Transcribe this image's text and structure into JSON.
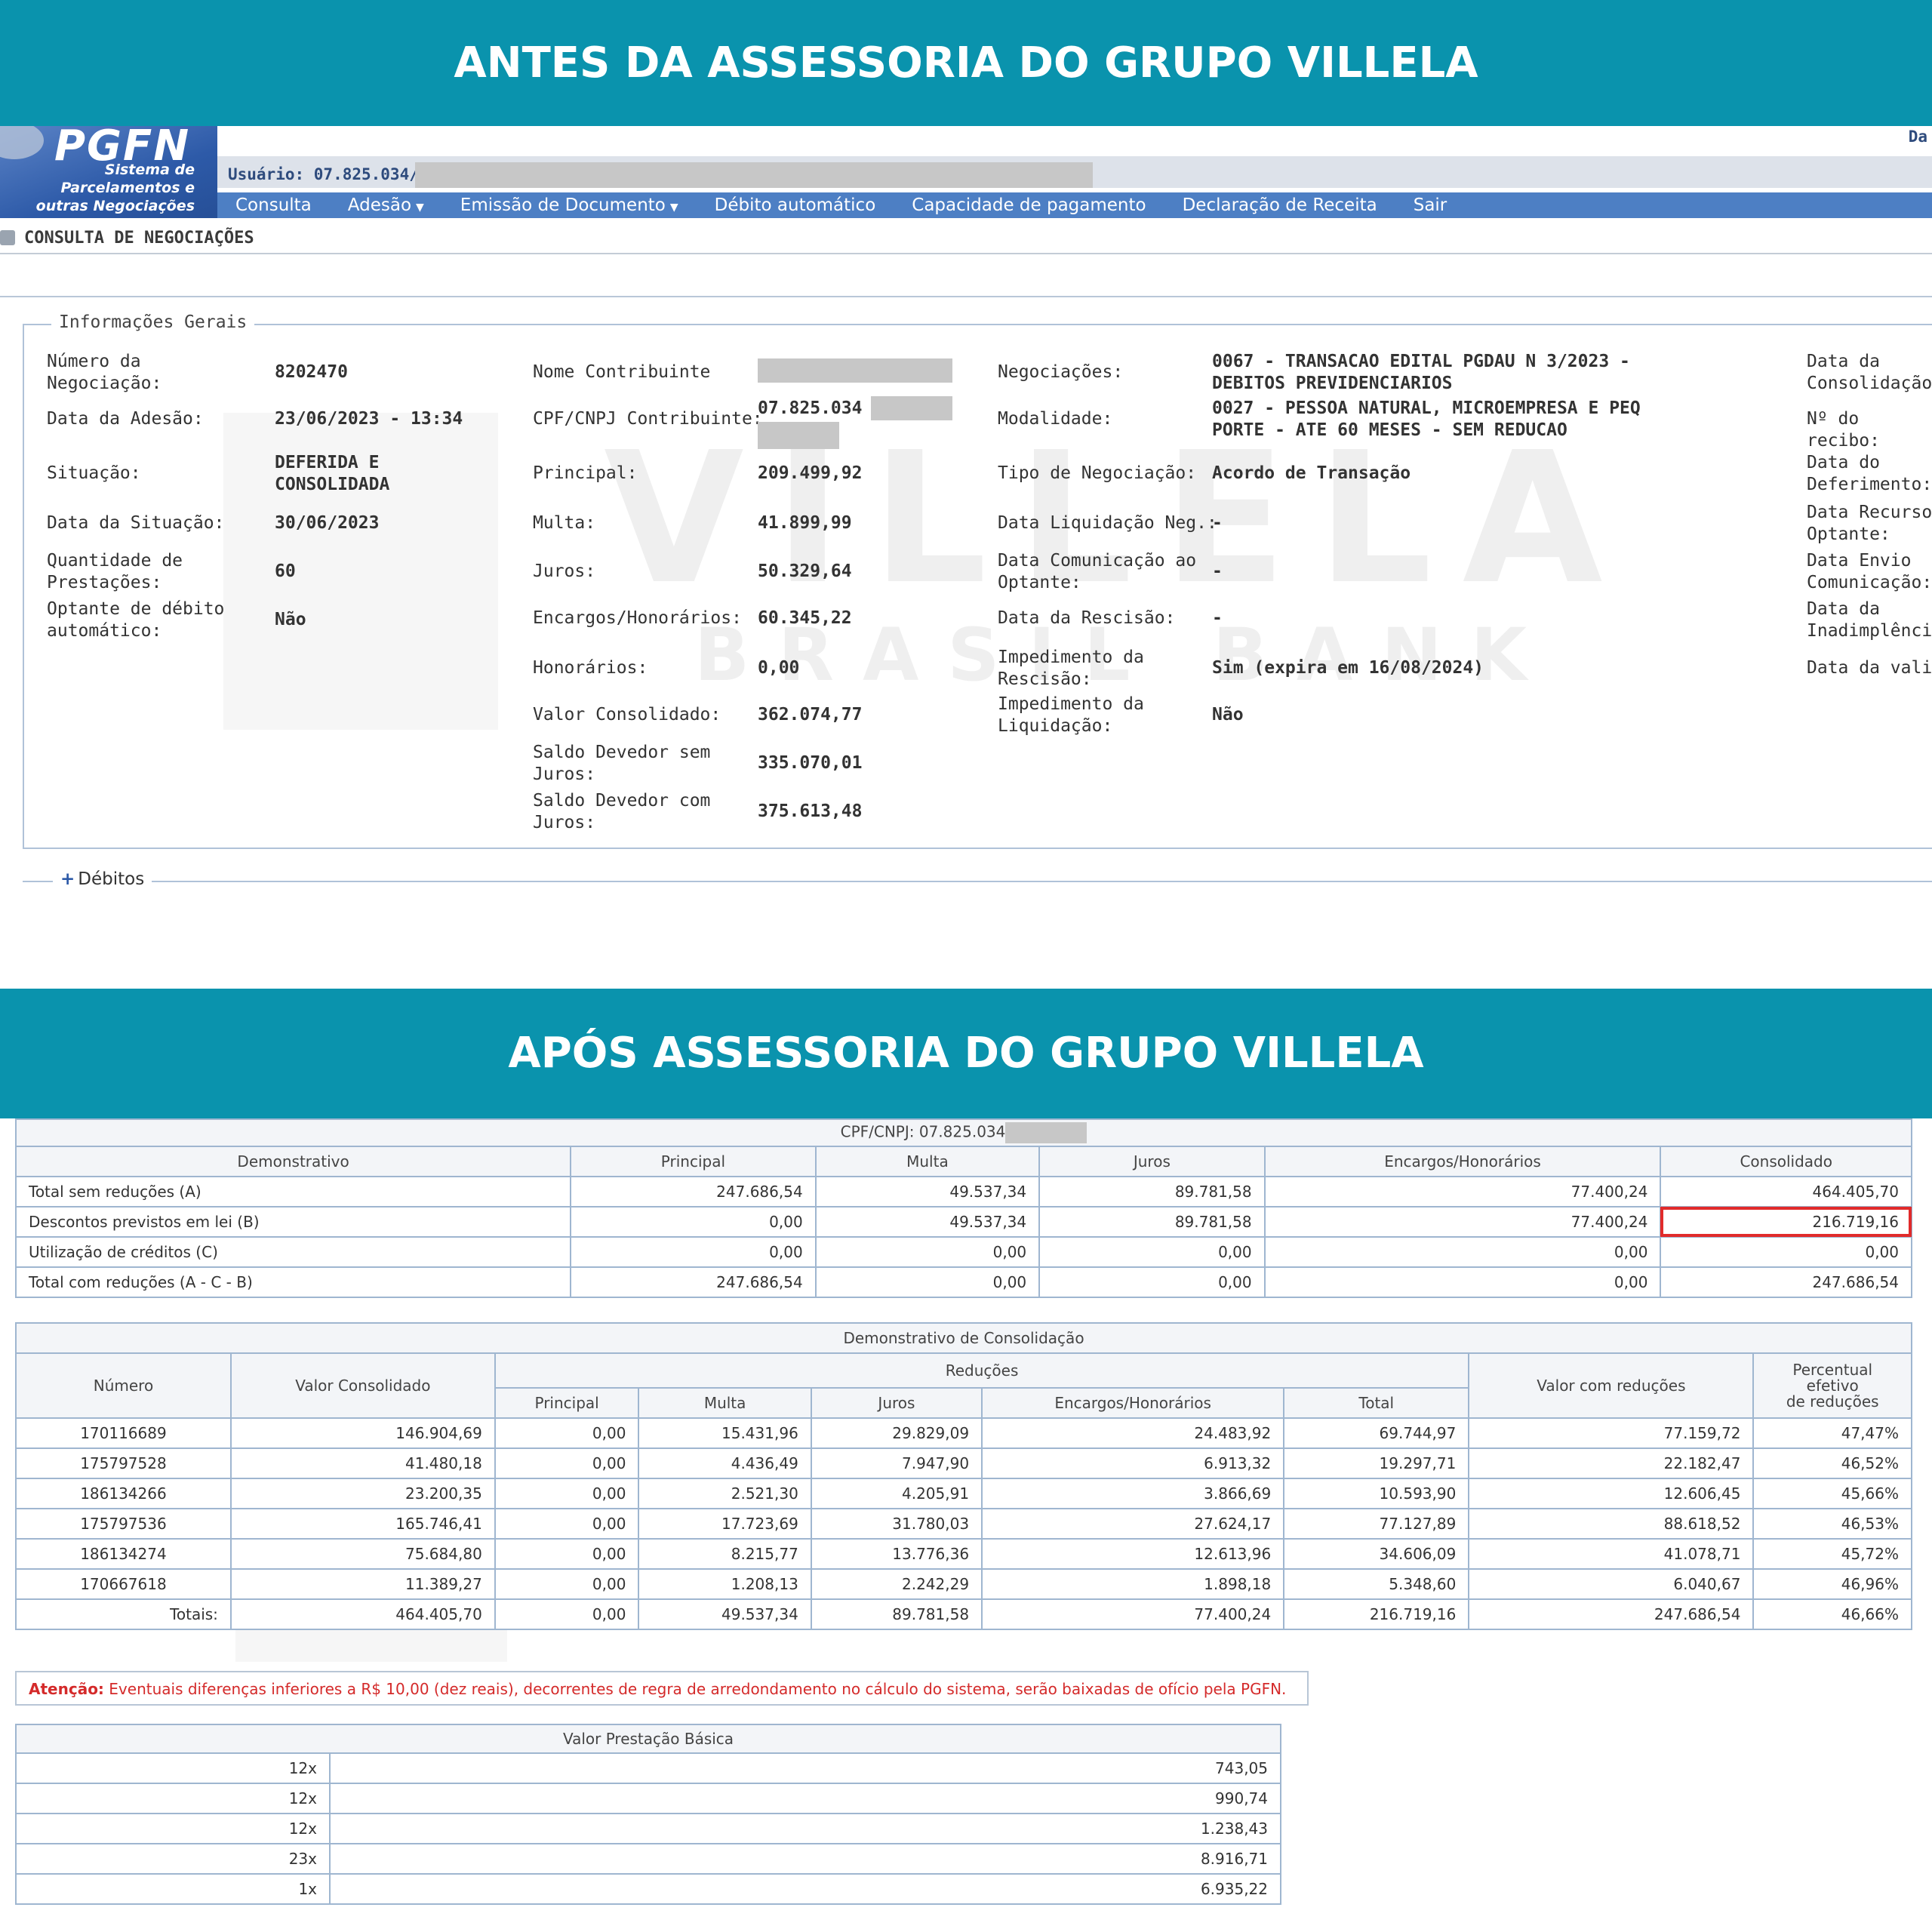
{
  "banners": {
    "before": "ANTES DA ASSESSORIA DO GRUPO VILLELA",
    "after": "APÓS ASSESSORIA DO GRUPO VILLELA"
  },
  "watermark": {
    "brand": "VILLELA",
    "sub": "BRASIL BANK"
  },
  "colors": {
    "banner": "#0a93ad",
    "menu": "#4d7fc4",
    "highlight": "#e12b2b",
    "warning": "#d42a2a"
  },
  "pgfn": {
    "logo": "PGFN",
    "logo_sub": [
      "Sistema de",
      "Parcelamentos e",
      "outras Negociações"
    ],
    "user_label": "Usuário: 07.825.034/",
    "top_right": "Da",
    "menu": [
      {
        "label": "Consulta",
        "caret": false
      },
      {
        "label": "Adesão",
        "caret": true
      },
      {
        "label": "Emissão de Documento",
        "caret": true
      },
      {
        "label": "Débito automático",
        "caret": false
      },
      {
        "label": "Capacidade de pagamento",
        "caret": false
      },
      {
        "label": "Declaração de Receita",
        "caret": false
      },
      {
        "label": "Sair",
        "caret": false
      }
    ],
    "page_title": "CONSULTA DE NEGOCIAÇÕES",
    "section_title": "Informações Gerais",
    "col1": [
      {
        "label": "Número da\nNegociação:",
        "value": "8202470"
      },
      {
        "label": "Data da Adesão:",
        "value": "23/06/2023 - 13:34"
      },
      {
        "label": "Situação:",
        "value": "DEFERIDA E\nCONSOLIDADA"
      },
      {
        "label": "Data da Situação:",
        "value": "30/06/2023"
      },
      {
        "label": "Quantidade de\nPrestações:",
        "value": "60"
      },
      {
        "label": "Optante de débito\nautomático:",
        "value": "Não"
      }
    ],
    "col2": [
      {
        "label": "Nome Contribuinte",
        "value": ""
      },
      {
        "label": "CPF/CNPJ Contribuinte:",
        "value": "07.825.034"
      },
      {
        "label": "Principal:",
        "value": "209.499,92"
      },
      {
        "label": "Multa:",
        "value": "41.899,99"
      },
      {
        "label": "Juros:",
        "value": "50.329,64"
      },
      {
        "label": "Encargos/Honorários:",
        "value": "60.345,22"
      },
      {
        "label": "Honorários:",
        "value": "0,00"
      },
      {
        "label": "Valor Consolidado:",
        "value": "362.074,77"
      },
      {
        "label": "Saldo Devedor sem\nJuros:",
        "value": "335.070,01"
      },
      {
        "label": "Saldo Devedor com\nJuros:",
        "value": "375.613,48"
      }
    ],
    "col3": [
      {
        "label": "Negociações:",
        "value": "0067 - TRANSACAO EDITAL PGDAU N 3/2023 -\nDEBITOS PREVIDENCIARIOS"
      },
      {
        "label": "Modalidade:",
        "value": "0027 - PESSOA NATURAL, MICROEMPRESA E PEQ\nPORTE - ATE 60 MESES - SEM REDUCAO"
      },
      {
        "label": "Tipo de Negociação:",
        "value": "Acordo de Transação"
      },
      {
        "label": "Data Liquidação Neg.:",
        "value": "-"
      },
      {
        "label": "Data Comunicação ao\nOptante:",
        "value": "-"
      },
      {
        "label": "Data da Rescisão:",
        "value": "-"
      },
      {
        "label": "Impedimento da\nRescisão:",
        "value": "Sim (expira em 16/08/2024)"
      },
      {
        "label": "Impedimento da\nLiquidação:",
        "value": "Não"
      }
    ],
    "col4": [
      "Data da\nConsolidação:",
      "Nº do recibo:",
      "Data do\nDeferimento:",
      "Data Recurso\nOptante:",
      "Data Envio\nComunicação:",
      "Data da\nInadimplência",
      "Data da valida"
    ],
    "debitos": "Débitos"
  },
  "resumo": {
    "caption": "CPF/CNPJ: 07.825.034",
    "headers": [
      "Demonstrativo",
      "Principal",
      "Multa",
      "Juros",
      "Encargos/Honorários",
      "Consolidado"
    ],
    "rows": [
      [
        "Total sem reduções (A)",
        "247.686,54",
        "49.537,34",
        "89.781,58",
        "77.400,24",
        "464.405,70"
      ],
      [
        "Descontos previstos em lei (B)",
        "0,00",
        "49.537,34",
        "89.781,58",
        "77.400,24",
        "216.719,16"
      ],
      [
        "Utilização de créditos (C)",
        "0,00",
        "0,00",
        "0,00",
        "0,00",
        "0,00"
      ],
      [
        "Total com reduções (A - C - B)",
        "247.686,54",
        "0,00",
        "0,00",
        "0,00",
        "247.686,54"
      ]
    ]
  },
  "consolidacao": {
    "caption": "Demonstrativo de Consolidação",
    "h_numero": "Número",
    "h_valor": "Valor Consolidado",
    "h_reducoes": "Reduções",
    "h_sub": [
      "Principal",
      "Multa",
      "Juros",
      "Encargos/Honorários",
      "Total"
    ],
    "h_com_reducoes": "Valor com reduções",
    "h_percentual": [
      "Percentual",
      "efetivo",
      "de reduções"
    ],
    "rows": [
      [
        "170116689",
        "146.904,69",
        "0,00",
        "15.431,96",
        "29.829,09",
        "24.483,92",
        "69.744,97",
        "77.159,72",
        "47,47%"
      ],
      [
        "175797528",
        "41.480,18",
        "0,00",
        "4.436,49",
        "7.947,90",
        "6.913,32",
        "19.297,71",
        "22.182,47",
        "46,52%"
      ],
      [
        "186134266",
        "23.200,35",
        "0,00",
        "2.521,30",
        "4.205,91",
        "3.866,69",
        "10.593,90",
        "12.606,45",
        "45,66%"
      ],
      [
        "175797536",
        "165.746,41",
        "0,00",
        "17.723,69",
        "31.780,03",
        "27.624,17",
        "77.127,89",
        "88.618,52",
        "46,53%"
      ],
      [
        "186134274",
        "75.684,80",
        "0,00",
        "8.215,77",
        "13.776,36",
        "12.613,96",
        "34.606,09",
        "41.078,71",
        "45,72%"
      ],
      [
        "170667618",
        "11.389,27",
        "0,00",
        "1.208,13",
        "2.242,29",
        "1.898,18",
        "5.348,60",
        "6.040,67",
        "46,96%"
      ]
    ],
    "totals": [
      "Totais:",
      "464.405,70",
      "0,00",
      "49.537,34",
      "89.781,58",
      "77.400,24",
      "216.719,16",
      "247.686,54",
      "46,66%"
    ]
  },
  "warning": {
    "bold": "Atenção:",
    "text": " Eventuais diferenças inferiores a R$ 10,00 (dez reais), decorrentes de regra de arredondamento no cálculo do sistema, serão baixadas de ofício pela PGFN."
  },
  "prestacao": {
    "caption": "Valor Prestação Básica",
    "rows": [
      [
        "12x",
        "743,05"
      ],
      [
        "12x",
        "990,74"
      ],
      [
        "12x",
        "1.238,43"
      ],
      [
        "23x",
        "8.916,71"
      ],
      [
        "1x",
        "6.935,22"
      ]
    ]
  }
}
